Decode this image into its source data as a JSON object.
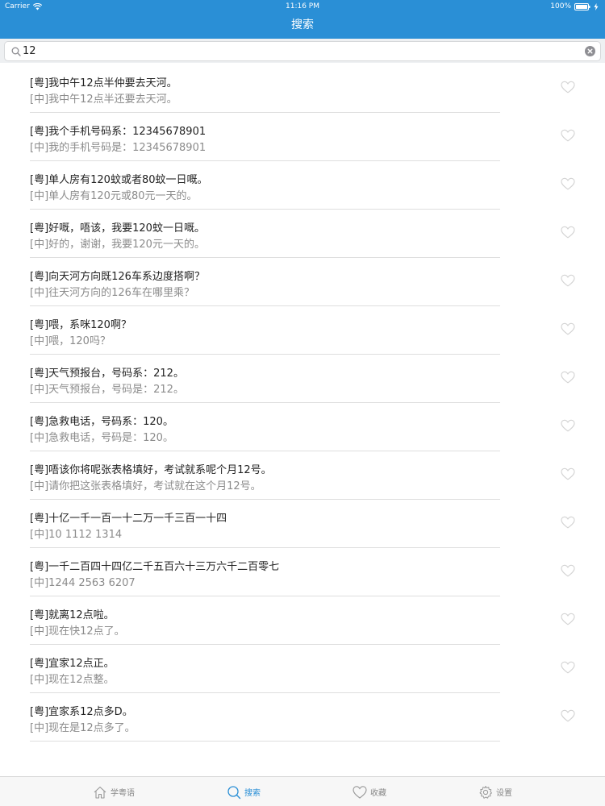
{
  "status": {
    "carrier": "Carrier",
    "time": "11:16 PM",
    "battery": "100%"
  },
  "nav": {
    "title": "搜索"
  },
  "search": {
    "value": "12",
    "placeholder": ""
  },
  "results": [
    {
      "yue": "[粤]我中午12点半仲要去天河。",
      "zh": "[中]我中午12点半还要去天河。"
    },
    {
      "yue": "[粤]我个手机号码系：12345678901",
      "zh": "[中]我的手机号码是：12345678901"
    },
    {
      "yue": "[粤]单人房有120蚊或者80蚊一日嘅。",
      "zh": "[中]单人房有120元或80元一天的。"
    },
    {
      "yue": "[粤]好嘅，唔该，我要120蚊一日嘅。",
      "zh": "[中]好的，谢谢，我要120元一天的。"
    },
    {
      "yue": "[粤]向天河方向既126车系边度搭啊？",
      "zh": "[中]往天河方向的126车在哪里乘？"
    },
    {
      "yue": "[粤]喂，系咪120啊？",
      "zh": "[中]喂，120吗？"
    },
    {
      "yue": "[粤]天气预报台，号码系：212。",
      "zh": "[中]天气预报台，号码是：212。"
    },
    {
      "yue": "[粤]急救电话，号码系：120。",
      "zh": "[中]急救电话，号码是：120。"
    },
    {
      "yue": "[粤]唔该你将呢张表格填好，考试就系呢个月12号。",
      "zh": "[中]请你把这张表格填好，考试就在这个月12号。"
    },
    {
      "yue": "[粤]十亿一千一百一十二万一千三百一十四",
      "zh": "[中]10 1112 1314"
    },
    {
      "yue": "[粤]一千二百四十四亿二千五百六十三万六千二百零七",
      "zh": "[中]1244 2563 6207"
    },
    {
      "yue": "[粤]就离12点啦。",
      "zh": "[中]现在快12点了。"
    },
    {
      "yue": "[粤]宜家12点正。",
      "zh": "[中]现在12点整。"
    },
    {
      "yue": "[粤]宜家系12点多D。",
      "zh": "[中]现在是12点多了。"
    }
  ],
  "tabs": [
    {
      "label": "学粤语",
      "icon": "home-icon"
    },
    {
      "label": "搜索",
      "icon": "search-icon"
    },
    {
      "label": "收藏",
      "icon": "heart-icon"
    },
    {
      "label": "设置",
      "icon": "gear-icon"
    }
  ],
  "colors": {
    "accent": "#2a8fd6",
    "secondary_text": "#8b8b8b"
  }
}
